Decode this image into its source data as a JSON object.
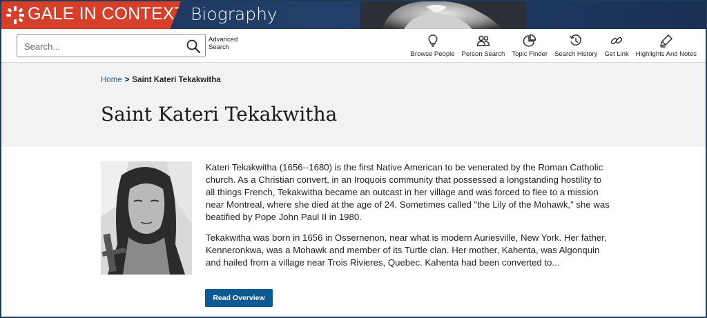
{
  "banner": {
    "brand": "GALE IN CONTEXT",
    "product": "Biography",
    "brand_color": "#d6402b",
    "banner_color": "#1e3a63"
  },
  "search": {
    "placeholder": "Search...",
    "value": "",
    "advanced_label": "Advanced Search",
    "icon": "search-icon"
  },
  "tools": [
    {
      "label": "Browse People",
      "icon": "lightbulb-icon"
    },
    {
      "label": "Person Search",
      "icon": "people-icon"
    },
    {
      "label": "Topic Finder",
      "icon": "pie-chart-icon"
    },
    {
      "label": "Search History",
      "icon": "history-icon"
    },
    {
      "label": "Get Link",
      "icon": "link-icon"
    },
    {
      "label": "Highlights And Notes",
      "icon": "highlighter-icon"
    }
  ],
  "breadcrumb": {
    "home": "Home",
    "separator": ">",
    "current": "Saint Kateri Tekakwitha"
  },
  "page_title": "Saint Kateri Tekakwitha",
  "article": {
    "paragraphs": [
      "Kateri Tekakwitha (1656--1680) is the first Native American to be venerated by the Roman Catholic church. As a Christian convert, in an Iroquois community that possessed a longstanding hostility to all things French, Tekakwitha became an outcast in her village and was forced to flee to a mission near Montreal, where she died at the age of 24. Sometimes called \"the Lily of the Mohawk,\" she was beatified by Pope John Paul II in 1980.",
      "Tekakwitha was born in 1656 in Ossernenon, near what is modern Auriesville, New York. Her father, Kenneronkwa, was a Mohawk and member of its Turtle clan. Her mother, Kahenta, was Algonquin and hailed from a village near Trois Rivieres, Quebec. Kahenta had been converted to..."
    ],
    "read_button": "Read Overview",
    "button_color": "#0b5a93"
  }
}
